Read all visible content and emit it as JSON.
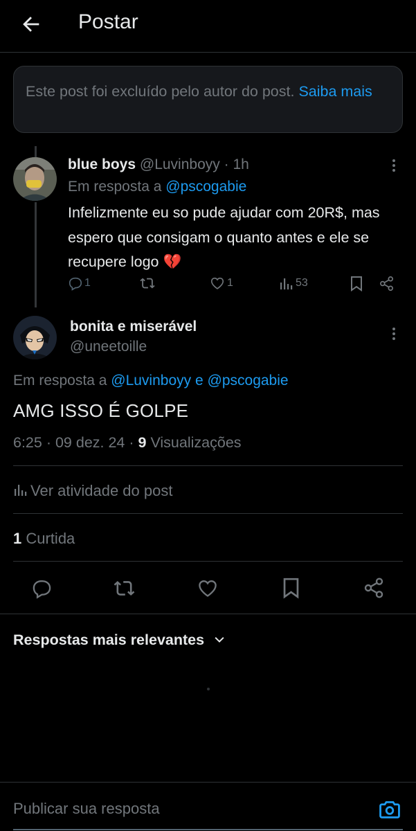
{
  "header": {
    "title": "Postar",
    "back_icon": "arrow-left-icon"
  },
  "deleted_notice": {
    "text": "Este post foi excluído pelo autor do post.",
    "link": "Saiba mais"
  },
  "reply_post": {
    "name": "blue boys",
    "handle": "@Luvinboyy",
    "sep": "·",
    "time": "1h",
    "reply_prefix": "Em resposta a",
    "reply_to": "@pscogabie",
    "text": "Infelizmente eu so pude ajudar com 20R$, mas espero que consigam o quanto antes e ele se recupere logo 💔",
    "replies": "1",
    "likes": "1",
    "views": "53"
  },
  "main_post": {
    "name": "bonita e miserável",
    "handle": "@uneetoille",
    "reply_prefix": "Em resposta a",
    "reply_to_1": "@Luvinboyy",
    "reply_conj": "e",
    "reply_to_2": "@pscogabie",
    "text": "AMG ISSO É GOLPE",
    "time": "6:25",
    "date": "09 dez. 24",
    "views_count": "9",
    "views_label": "Visualizações",
    "activity_label": "Ver atividade do post",
    "likes_count": "1",
    "likes_label": "Curtida"
  },
  "sort": {
    "label": "Respostas mais relevantes"
  },
  "compose": {
    "placeholder": "Publicar sua resposta"
  },
  "colors": {
    "accent": "#1d9bf0",
    "background": "#000000",
    "muted": "#71767b",
    "text": "#e7e9ea"
  }
}
